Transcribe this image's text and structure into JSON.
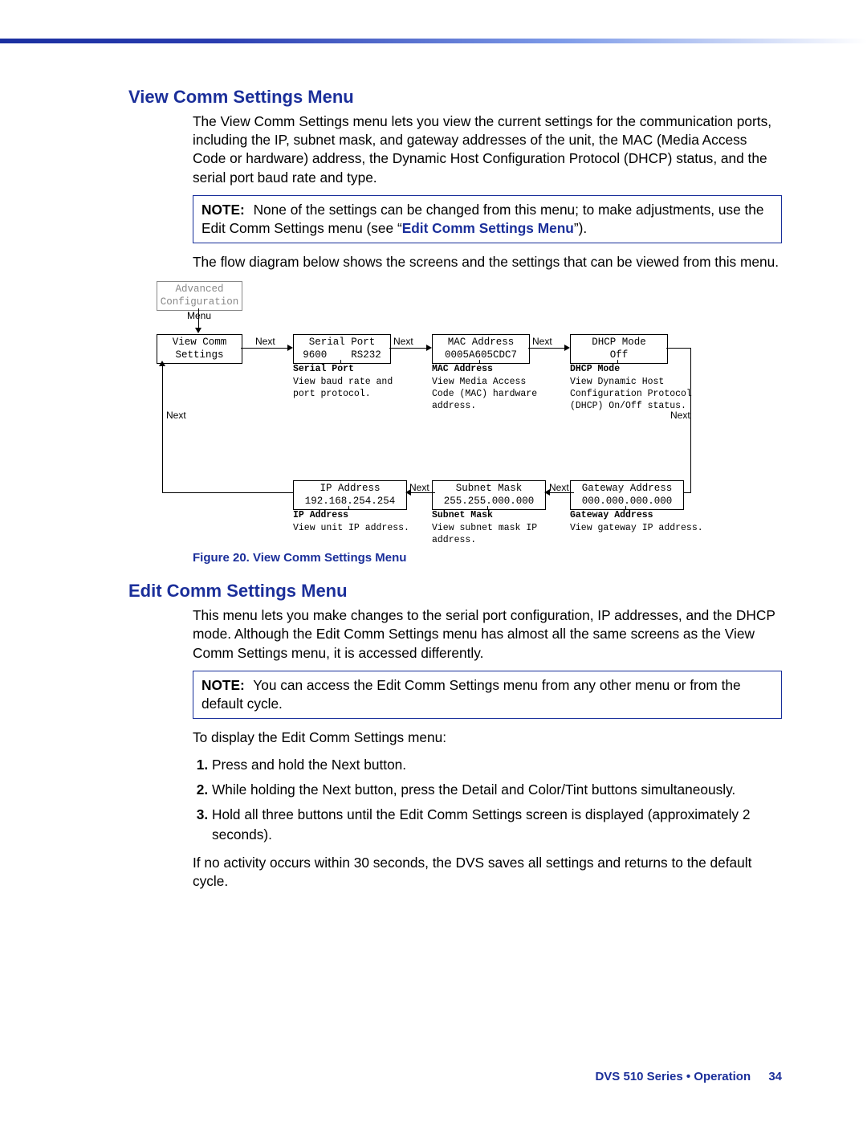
{
  "section1": {
    "heading": "View Comm Settings Menu",
    "p1": "The View Comm Settings menu lets you view the current settings for the communication ports, including the IP, subnet mask, and gateway addresses of the unit, the MAC (Media Access Code or hardware) address, the Dynamic Host Configuration Protocol (DHCP) status, and the serial port baud rate and type.",
    "note_label": "NOTE:",
    "note_text_a": "None of the settings can be changed from this menu; to make adjustments, use the Edit Comm Settings menu (see “",
    "note_link": "Edit Comm Settings Menu",
    "note_text_b": "”).",
    "p2": "The flow diagram below shows the screens and the settings that can be viewed from this menu.",
    "figure_caption": "Figure 20.   View Comm Settings Menu"
  },
  "diagram": {
    "advanced": "Advanced\nConfiguration",
    "menu_label": "Menu",
    "view_comm": "View Comm\nSettings",
    "serial_port_box": "Serial Port\n9600    RS232",
    "mac_box": "MAC Address\n0005A605CDC7",
    "dhcp_box": "DHCP Mode\nOff",
    "ip_box": "IP Address\n192.168.254.254",
    "subnet_box": "Subnet Mask\n255.255.000.000",
    "gateway_box": "Gateway Address\n000.000.000.000",
    "next": "Next",
    "serial_port_title": "Serial Port",
    "serial_port_desc": "View baud rate and port protocol.",
    "mac_title": "MAC Address",
    "mac_desc": "View Media Access Code (MAC) hardware address.",
    "dhcp_title": "DHCP Mode",
    "dhcp_desc": "View Dynamic Host Configuration Protocol (DHCP) On/Off status.",
    "ip_title": "IP Address",
    "ip_desc": "View unit IP address.",
    "subnet_title": "Subnet Mask",
    "subnet_desc": "View subnet mask IP address.",
    "gateway_title": "Gateway Address",
    "gateway_desc": "View gateway IP address."
  },
  "section2": {
    "heading": "Edit Comm Settings Menu",
    "p1": "This menu lets you make changes to the serial port configuration, IP addresses, and the DHCP mode. Although the Edit Comm Settings menu has almost all the same screens as the View Comm Settings menu, it is accessed differently.",
    "note_label": "NOTE:",
    "note_text": "You can access the Edit Comm Settings menu from any other menu or from the default cycle.",
    "p2": "To display the Edit Comm Settings menu:",
    "step1": "Press and hold the Next button.",
    "step2": "While holding the Next button, press the Detail and Color/Tint buttons simultaneously.",
    "step3": "Hold all three buttons until the Edit Comm Settings screen is displayed (approximately 2 seconds).",
    "p3": "If no activity occurs within 30 seconds, the DVS saves all settings and returns to the default cycle."
  },
  "footer": {
    "text": "DVS 510 Series • Operation",
    "page": "34"
  }
}
